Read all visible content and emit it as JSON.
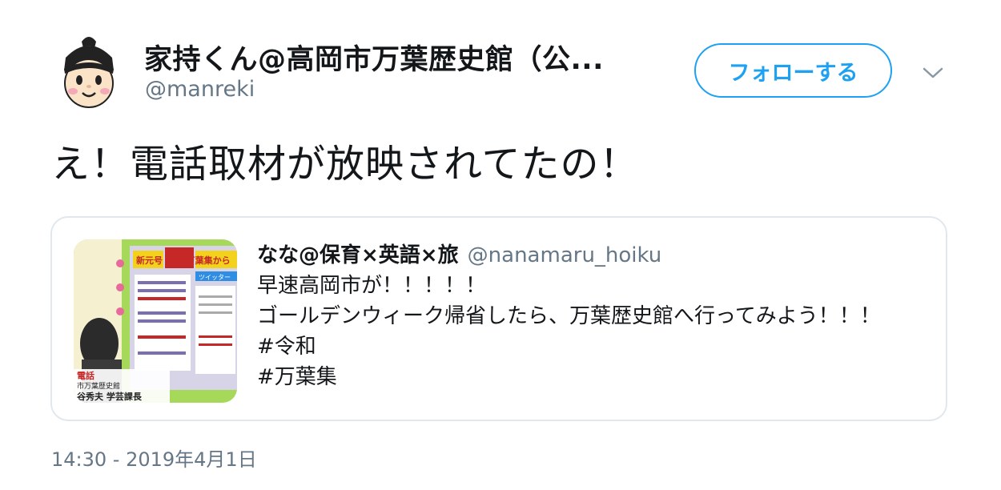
{
  "author": {
    "display_name": "家持くん@高岡市万葉歴史館（公...",
    "handle": "@manreki",
    "avatar_icon": "cartoon-character-avatar"
  },
  "follow_button": {
    "label": "フォローする"
  },
  "menu": {
    "icon": "chevron-down-icon"
  },
  "tweet": {
    "text": "え！電話取材が放映されてたの！"
  },
  "quoted_tweet": {
    "display_name": "なな@保育×英語×旅",
    "handle": "@nanamaru_hoiku",
    "lines": [
      "早速高岡市が！！！！！",
      "ゴールデンウィーク帰省したら、万葉歴史館へ行ってみよう！！！",
      "#令和",
      "#万葉集"
    ],
    "thumbnail": {
      "banner_text": "新元号 令和 万葉集から",
      "sub_text": "ツイッター",
      "caption_lines": [
        "電話",
        "市万葉歴史館",
        "谷秀夫 学芸課長"
      ]
    }
  },
  "timestamp": "14:30 - 2019年4月1日",
  "colors": {
    "accent": "#1da1f2",
    "secondary_text": "#657786",
    "border": "#e1e8ed"
  }
}
